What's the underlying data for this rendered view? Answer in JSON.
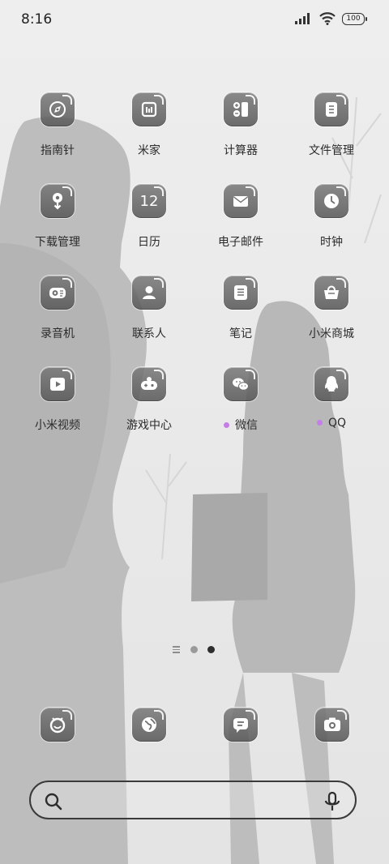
{
  "status_bar": {
    "time": "8:16",
    "battery": "100",
    "icons": [
      "signal-icon",
      "wifi-icon",
      "battery-icon"
    ]
  },
  "apps": [
    {
      "label": "指南针",
      "icon": "compass-icon"
    },
    {
      "label": "米家",
      "icon": "mijia-icon"
    },
    {
      "label": "计算器",
      "icon": "calculator-icon"
    },
    {
      "label": "文件管理",
      "icon": "file-manager-icon"
    },
    {
      "label": "下载管理",
      "icon": "download-icon"
    },
    {
      "label": "日历",
      "icon": "calendar-icon",
      "icon_text": "12"
    },
    {
      "label": "电子邮件",
      "icon": "mail-icon"
    },
    {
      "label": "时钟",
      "icon": "clock-icon"
    },
    {
      "label": "录音机",
      "icon": "recorder-icon"
    },
    {
      "label": "联系人",
      "icon": "contacts-icon"
    },
    {
      "label": "笔记",
      "icon": "notes-icon"
    },
    {
      "label": "小米商城",
      "icon": "mi-store-icon"
    },
    {
      "label": "小米视频",
      "icon": "video-icon"
    },
    {
      "label": "游戏中心",
      "icon": "game-center-icon"
    },
    {
      "label": "微信",
      "icon": "wechat-icon",
      "badge": true
    },
    {
      "label": "QQ",
      "icon": "qq-icon",
      "badge": true
    }
  ],
  "page_indicator": {
    "pages": 2,
    "active": 2
  },
  "dock": [
    {
      "icon": "phone-assistant-icon"
    },
    {
      "icon": "browser-icon"
    },
    {
      "icon": "messages-icon"
    },
    {
      "icon": "camera-icon"
    }
  ],
  "search": {
    "placeholder": ""
  },
  "colors": {
    "badge": "#c47ee8",
    "icon_bg": "#6f6f6f",
    "active_dot": "#2d2d2d",
    "inactive_dot": "#9a9a9a"
  }
}
